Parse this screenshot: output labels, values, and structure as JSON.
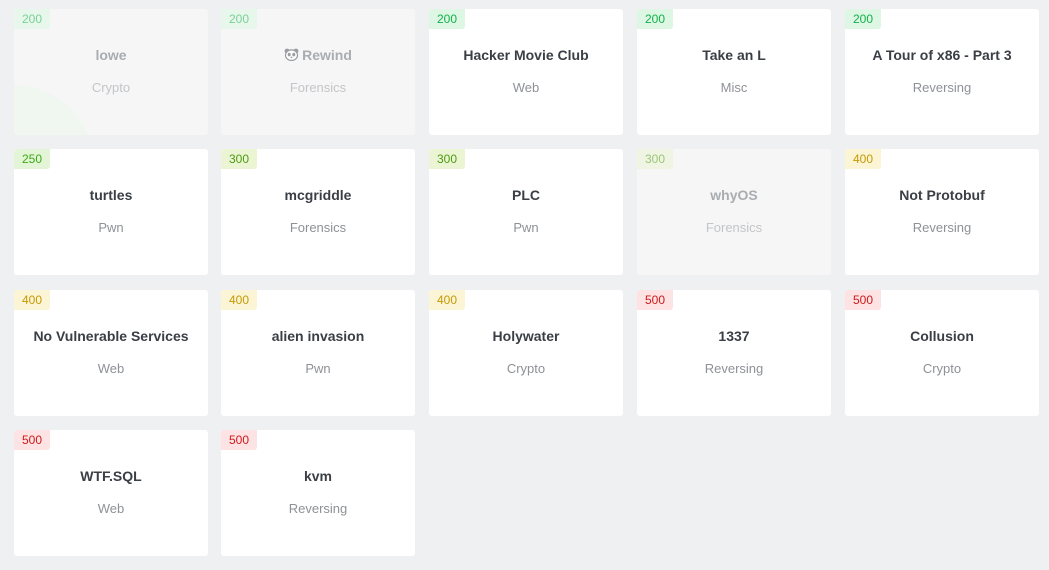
{
  "colors": {
    "tier_200": {
      "bg": "#ddf7e4",
      "fg": "#12b24a"
    },
    "tier_250": {
      "bg": "#e3f5d6",
      "fg": "#3eaa15"
    },
    "tier_300": {
      "bg": "#ebf5d4",
      "fg": "#4f9a12"
    },
    "tier_400": {
      "bg": "#fbf4d5",
      "fg": "#c49a05"
    },
    "tier_500": {
      "bg": "#fde3e3",
      "fg": "#d01919"
    }
  },
  "challenges": [
    {
      "points": "200",
      "tier": "tier_200",
      "title": "lowe",
      "category": "Crypto",
      "solved": true,
      "icon": ""
    },
    {
      "points": "200",
      "tier": "tier_200",
      "title": "Rewind",
      "category": "Forensics",
      "solved": true,
      "icon": "panda-icon"
    },
    {
      "points": "200",
      "tier": "tier_200",
      "title": "Hacker Movie Club",
      "category": "Web",
      "solved": false,
      "icon": ""
    },
    {
      "points": "200",
      "tier": "tier_200",
      "title": "Take an L",
      "category": "Misc",
      "solved": false,
      "icon": ""
    },
    {
      "points": "200",
      "tier": "tier_200",
      "title": "A Tour of x86 - Part 3",
      "category": "Reversing",
      "solved": false,
      "icon": ""
    },
    {
      "points": "250",
      "tier": "tier_250",
      "title": "turtles",
      "category": "Pwn",
      "solved": false,
      "icon": ""
    },
    {
      "points": "300",
      "tier": "tier_300",
      "title": "mcgriddle",
      "category": "Forensics",
      "solved": false,
      "icon": ""
    },
    {
      "points": "300",
      "tier": "tier_300",
      "title": "PLC",
      "category": "Pwn",
      "solved": false,
      "icon": ""
    },
    {
      "points": "300",
      "tier": "tier_300",
      "title": "whyOS",
      "category": "Forensics",
      "solved": true,
      "icon": ""
    },
    {
      "points": "400",
      "tier": "tier_400",
      "title": "Not Protobuf",
      "category": "Reversing",
      "solved": false,
      "icon": ""
    },
    {
      "points": "400",
      "tier": "tier_400",
      "title": "No Vulnerable Services",
      "category": "Web",
      "solved": false,
      "icon": ""
    },
    {
      "points": "400",
      "tier": "tier_400",
      "title": "alien invasion",
      "category": "Pwn",
      "solved": false,
      "icon": ""
    },
    {
      "points": "400",
      "tier": "tier_400",
      "title": "Holywater",
      "category": "Crypto",
      "solved": false,
      "icon": ""
    },
    {
      "points": "500",
      "tier": "tier_500",
      "title": "1337",
      "category": "Reversing",
      "solved": false,
      "icon": ""
    },
    {
      "points": "500",
      "tier": "tier_500",
      "title": "Collusion",
      "category": "Crypto",
      "solved": false,
      "icon": ""
    },
    {
      "points": "500",
      "tier": "tier_500",
      "title": "WTF.SQL",
      "category": "Web",
      "solved": false,
      "icon": ""
    },
    {
      "points": "500",
      "tier": "tier_500",
      "title": "kvm",
      "category": "Reversing",
      "solved": false,
      "icon": ""
    }
  ]
}
